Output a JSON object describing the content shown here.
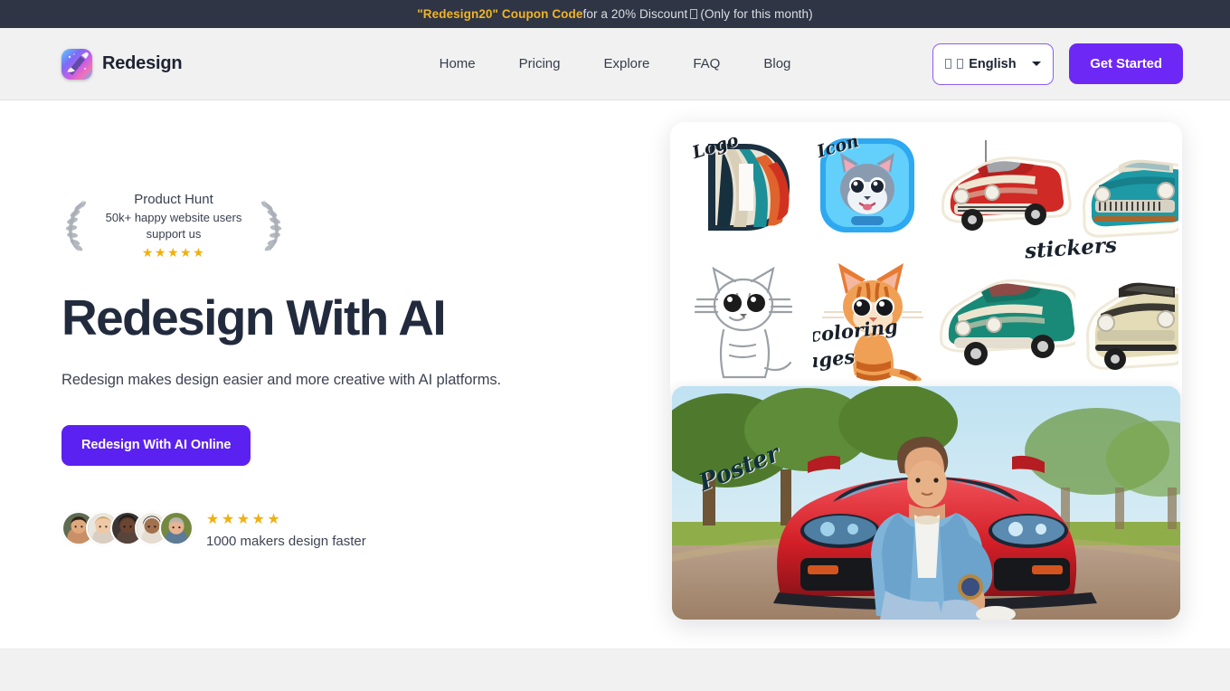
{
  "promo": {
    "coupon": "\"Redesign20\" Coupon Code",
    "rest_before": " for a 20% Discount ",
    "rest_after": " (Only for this month)"
  },
  "header": {
    "brand_name": "Redesign",
    "logo_icon": "paintbrush-gradient-icon",
    "nav": [
      {
        "label": "Home"
      },
      {
        "label": "Pricing"
      },
      {
        "label": "Explore"
      },
      {
        "label": "FAQ"
      },
      {
        "label": "Blog"
      }
    ],
    "language": {
      "label": "English",
      "flag_icon": "flag-emoji-missing-glyph",
      "caret_icon": "chevron-down-icon"
    },
    "cta_label": "Get Started"
  },
  "hero": {
    "badge": {
      "title": "Product Hunt",
      "subtitle_line1": "50k+ happy website users",
      "subtitle_line2": "support us",
      "stars": "★★★★★",
      "left_icon": "laurel-branch-left-icon",
      "right_icon": "laurel-branch-right-icon"
    },
    "title": "Redesign With AI",
    "subtitle": "Redesign makes design easier and more creative with AI platforms.",
    "cta_label": "Redesign With AI Online",
    "social_proof": {
      "stars": "★★★★★",
      "label": "1000 makers design faster",
      "avatar_count": 5
    },
    "collage": {
      "labels": [
        {
          "text": "Logo"
        },
        {
          "text": "Icon"
        },
        {
          "text": "stickers"
        },
        {
          "text": "coloring"
        },
        {
          "text": "pages"
        },
        {
          "text": "Poster"
        }
      ],
      "tiles": [
        {
          "name": "logo-letter-d-tile"
        },
        {
          "name": "app-icon-cat-tile"
        },
        {
          "name": "red-classic-car-sticker-tile"
        },
        {
          "name": "teal-classic-car-sticker-tile"
        },
        {
          "name": "coloring-page-cat-tile"
        },
        {
          "name": "orange-cat-illustration-tile"
        },
        {
          "name": "green-roadster-sticker-tile"
        },
        {
          "name": "cream-classic-car-sticker-tile"
        }
      ],
      "poster": {
        "name": "poster-man-with-red-sports-car"
      }
    }
  },
  "colors": {
    "banner_bg": "#2f3545",
    "coupon_accent": "#f0b429",
    "brand_purple": "#6d28f5",
    "hero_cta_purple": "#5b21f0",
    "star_gold": "#f0b010",
    "heading": "#222a3d",
    "header_bg": "#f1f1f1"
  }
}
